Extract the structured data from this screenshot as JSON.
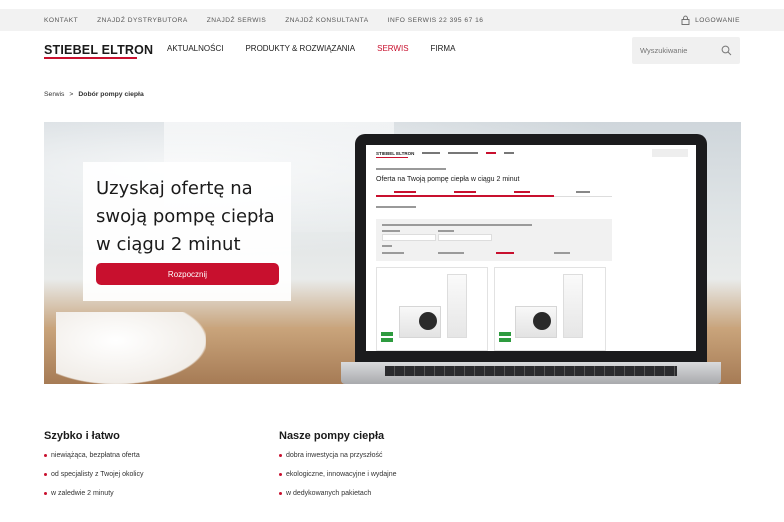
{
  "colors": {
    "accent": "#c8102e",
    "topbar_bg": "#f2f2f2",
    "text": "#1a1a1a"
  },
  "topbar": {
    "links": [
      "KONTAKT",
      "ZNAJDŹ DYSTRYBUTORA",
      "ZNAJDŹ SERWIS",
      "ZNAJDŹ KONSULTANTA",
      "INFO SERWIS 22 395 67 16"
    ],
    "login_label": "LOGOWANIE",
    "login_icon": "lock-icon"
  },
  "header": {
    "logo": "STIEBEL ELTRON",
    "nav": [
      "AKTUALNOŚCI",
      "PRODUKTY & ROZWIĄZANIA",
      "SERWIS",
      "FIRMA"
    ],
    "active_nav": "SERWIS",
    "search": {
      "placeholder": "Wyszukiwanie",
      "value": "",
      "icon": "search-icon"
    }
  },
  "breadcrumb": {
    "root": "Serwis",
    "separator": ">",
    "current": "Dobór pompy ciepła"
  },
  "hero": {
    "title": "Uzyskaj ofertę na swoją pompę ciepła w ciągu 2 minut",
    "cta_label": "Rozpocznij",
    "screen": {
      "logo": "STIEBEL ELTRON",
      "title": "Oferta na Twoją pompę ciepła w ciągu 2 minut"
    }
  },
  "sections": [
    {
      "title": "Szybko i łatwo",
      "items": [
        "niewiążąca, bezpłatna oferta",
        "od specjalisty z Twojej okolicy",
        "w zaledwie 2 minuty"
      ]
    },
    {
      "title": "Nasze pompy ciepła",
      "items": [
        "dobra inwestycja na przyszłość",
        "ekologiczne, innowacyjne i wydajne",
        "w dedykowanych pakietach"
      ]
    }
  ]
}
